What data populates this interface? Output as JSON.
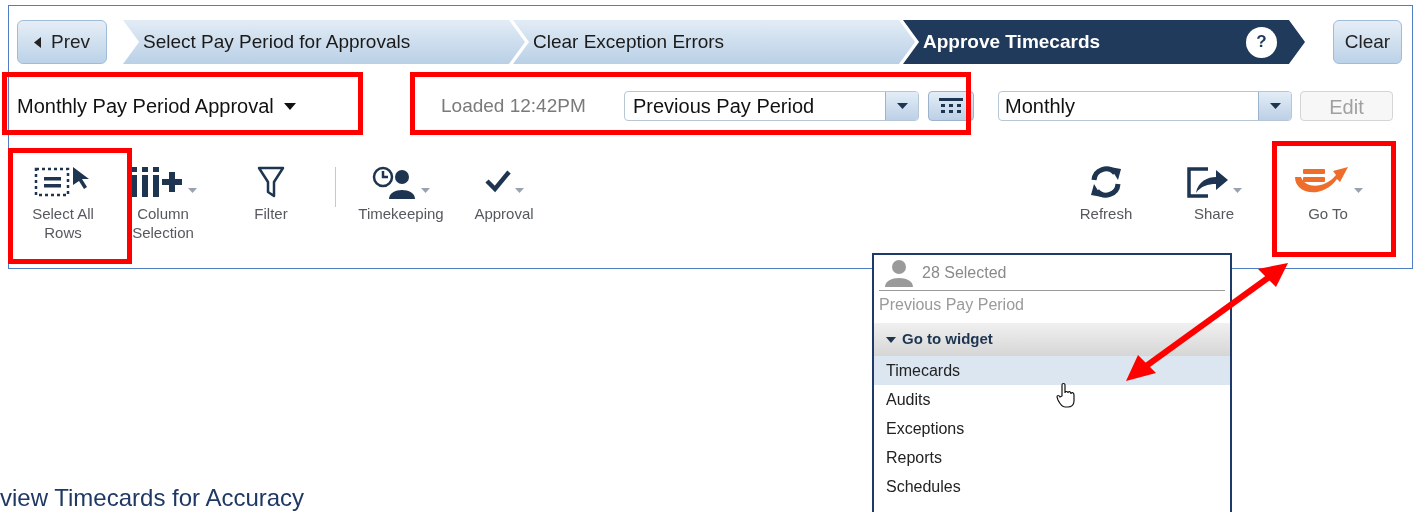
{
  "nav": {
    "prev": "Prev",
    "help": "?",
    "clear": "Clear"
  },
  "steps": [
    {
      "label": "Select Pay Period for Approvals",
      "selected": false
    },
    {
      "label": "Clear Exception Errors",
      "selected": false
    },
    {
      "label": "Approve Timecards",
      "selected": true
    }
  ],
  "view_selector": "Monthly Pay Period Approval",
  "loaded": "Loaded 12:42PM",
  "period_select": {
    "value": "Previous Pay Period"
  },
  "schedule_select": {
    "value": "Monthly"
  },
  "edit_button": {
    "label": "Edit",
    "disabled": true
  },
  "toolbar_left": [
    {
      "kind": "select_rows",
      "label": "Select All Rows",
      "caret": false
    },
    {
      "kind": "columns",
      "label": "Column Selection",
      "caret": true
    },
    {
      "kind": "filter",
      "label": "Filter",
      "caret": false
    },
    {
      "kind": "divider"
    },
    {
      "kind": "timekeeping",
      "label": "Timekeeping",
      "caret": true
    },
    {
      "kind": "approval",
      "label": "Approval",
      "caret": true
    }
  ],
  "toolbar_right": [
    {
      "kind": "refresh",
      "label": "Refresh",
      "caret": false
    },
    {
      "kind": "share",
      "label": "Share",
      "caret": true
    },
    {
      "kind": "goto",
      "label": "Go To",
      "caret": true
    }
  ],
  "menu": {
    "count": "28 Selected",
    "period": "Previous Pay Period",
    "section": {
      "label": "Go to widget",
      "expanded": true
    },
    "items": [
      {
        "label": "Timecards",
        "selected": true
      },
      {
        "label": "Audits",
        "selected": false
      },
      {
        "label": "Exceptions",
        "selected": false
      },
      {
        "label": "Reports",
        "selected": false
      },
      {
        "label": "Schedules",
        "selected": false
      }
    ]
  },
  "heading": "view Timecards for Accuracy"
}
